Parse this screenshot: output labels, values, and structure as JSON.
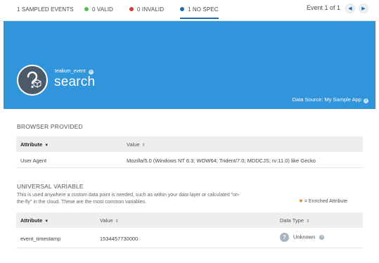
{
  "tabs": {
    "all": "1 SAMPLED EVENTS",
    "valid": "0 VALID",
    "invalid": "0 INVALID",
    "no_spec": "1 NO SPEC"
  },
  "colors": {
    "valid": "#4cc24c",
    "invalid": "#d9363e",
    "no_spec": "#1c6cb2",
    "hero": "#3195dc"
  },
  "event_counter": "Event 1 of 1",
  "nav": {
    "prev_icon": "chevron-left-icon",
    "next_icon": "chevron-right-icon"
  },
  "event": {
    "type": "tealium_event",
    "name": "search",
    "data_source": "Data Source: My Sample App"
  },
  "browser_provided": {
    "title": "BROWSER PROVIDED",
    "columns": {
      "attribute": "Attribute",
      "value": "Value"
    },
    "rows": [
      {
        "attribute": "User Agent",
        "value": "Mozilla/5.0 (Windows NT 6.3; WOW64; Trident/7.0; MDDCJS; rv:11.0) like Gecko"
      }
    ]
  },
  "universal_variable": {
    "title": "UNIVERSAL VARIABLE",
    "description_line1": "This is used anywhere a custom data point is needed, such as within your data layer or calculated \"on-",
    "description_line2": "the-fly\" in the cloud. These are the most common variables.",
    "enriched_label": "= Enriched Attribute",
    "columns": {
      "attribute": "Attribute",
      "value": "Value",
      "data_type": "Data Type"
    },
    "rows": [
      {
        "attribute": "event_timestamp",
        "value": "1534457730000",
        "data_type": "Unknown"
      }
    ]
  }
}
